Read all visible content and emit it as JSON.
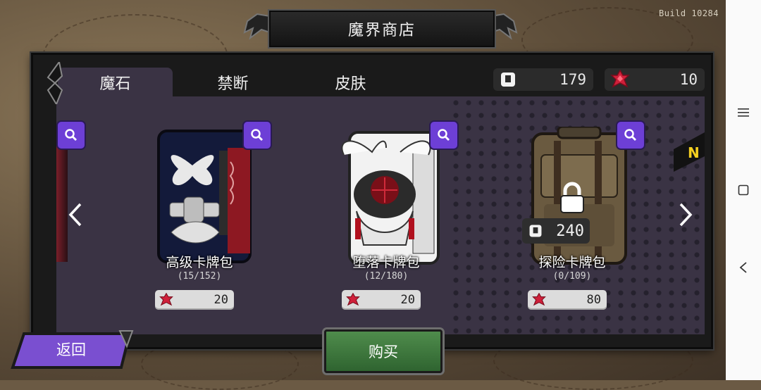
{
  "build_label": "Build 10284",
  "title": "魔界商店",
  "tabs": [
    {
      "label": "魔石",
      "active": true
    },
    {
      "label": "禁断",
      "active": false
    },
    {
      "label": "皮肤",
      "active": false
    }
  ],
  "currencies": [
    {
      "icon": "card-pack-icon",
      "value": "179"
    },
    {
      "icon": "red-gem-icon",
      "value": "10"
    }
  ],
  "packs": [
    {
      "name": "高级卡牌包",
      "count": "(15/152)",
      "price": "20",
      "locked": false
    },
    {
      "name": "堕落卡牌包",
      "count": "(12/180)",
      "price": "20",
      "locked": false
    },
    {
      "name": "探险卡牌包",
      "count": "(0/109)",
      "price": "80",
      "locked": true,
      "unlock_cost": "240"
    }
  ],
  "new_badge": "N",
  "buttons": {
    "back": "返回",
    "buy": "购买"
  },
  "colors": {
    "accent_purple": "#6d3fd6",
    "buy_green": "#3f7a3d",
    "panel": "#3a3344"
  }
}
